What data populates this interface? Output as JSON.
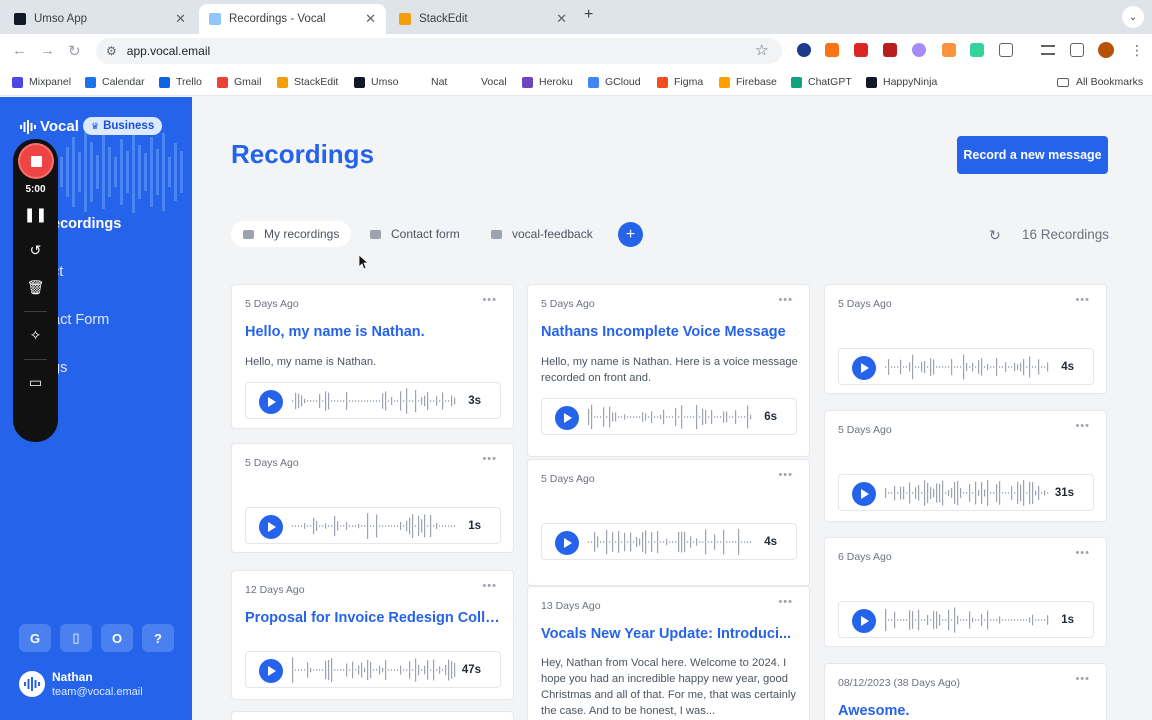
{
  "browser": {
    "tabs": [
      {
        "title": "Umso App",
        "active": false,
        "color": "#111827"
      },
      {
        "title": "Recordings - Vocal",
        "active": true,
        "color": "#60a5fa"
      },
      {
        "title": "StackEdit",
        "active": false,
        "color": "#f59e0b"
      }
    ],
    "url": "app.vocal.email",
    "bookmarks": [
      {
        "label": "Mixpanel",
        "color": "#4f46e5"
      },
      {
        "label": "Calendar",
        "color": "#1a73e8"
      },
      {
        "label": "Trello",
        "color": "#0c66e4"
      },
      {
        "label": "Gmail",
        "color": "#ea4335"
      },
      {
        "label": "StackEdit",
        "color": "#f59e0b"
      },
      {
        "label": "Umso",
        "color": "#111827"
      },
      {
        "label": "Nat",
        "color": "#ffffff"
      },
      {
        "label": "Vocal",
        "color": "#ffffff"
      },
      {
        "label": "Heroku",
        "color": "#6b46c1"
      },
      {
        "label": "GCloud",
        "color": "#4285f4"
      },
      {
        "label": "Figma",
        "color": "#f24e1e"
      },
      {
        "label": "Firebase",
        "color": "#ffa000"
      },
      {
        "label": "ChatGPT",
        "color": "#10a37f"
      },
      {
        "label": "HappyNinja",
        "color": "#111827"
      }
    ],
    "all_bookmarks": "All Bookmarks"
  },
  "sidebar": {
    "brand": "Vocal",
    "plan_badge": "Business",
    "nav": [
      {
        "label": "ecordings",
        "active": true
      },
      {
        "label": "ct",
        "active": false
      },
      {
        "label": "act Form",
        "active": false
      },
      {
        "label": "gs",
        "active": false
      }
    ],
    "integrations": [
      "G",
      "▯",
      "O",
      "?"
    ],
    "user": {
      "name": "Nathan",
      "email": "team@vocal.email"
    }
  },
  "recorder": {
    "time": "5:00"
  },
  "main": {
    "title": "Recordings",
    "record_button": "Record a new message",
    "folders": [
      {
        "label": "My recordings",
        "active": true
      },
      {
        "label": "Contact form",
        "active": false
      },
      {
        "label": "vocal-feedback",
        "active": false
      }
    ],
    "count": "16 Recordings"
  },
  "cards": [
    {
      "date": "5 Days Ago",
      "title": "Hello, my name is Nathan.",
      "body": "Hello, my name is Nathan.",
      "duration": "3s"
    },
    {
      "date": "5 Days Ago",
      "title": "",
      "body": "",
      "duration": "1s"
    },
    {
      "date": "12 Days Ago",
      "title": "Proposal for Invoice Redesign Colla...",
      "body": "",
      "duration": "47s"
    },
    {
      "date": "5 Days Ago",
      "title": "Nathans Incomplete Voice Message",
      "body": "Hello, my name is Nathan. Here is a voice message recorded on front and.",
      "duration": "6s"
    },
    {
      "date": "5 Days Ago",
      "title": "",
      "body": "",
      "duration": "4s"
    },
    {
      "date": "13 Days Ago",
      "title": "Vocals New Year Update: Introduci...",
      "body": "Hey, Nathan from Vocal here. Welcome to 2024. I hope you had an incredible happy new year, good Christmas and all of that. For me, that was certainly the case. And to be honest, I was...",
      "duration": ""
    },
    {
      "date": "5 Days Ago",
      "title": "",
      "body": "",
      "duration": "4s"
    },
    {
      "date": "5 Days Ago",
      "title": "",
      "body": "",
      "duration": "31s"
    },
    {
      "date": "6 Days Ago",
      "title": "",
      "body": "",
      "duration": "1s"
    },
    {
      "date": "08/12/2023 (38 Days Ago)",
      "title": "Awesome.",
      "body": "",
      "duration": ""
    }
  ],
  "colors": {
    "accent": "#2563eb",
    "sidebar": "#2563eb",
    "record_stop": "#ef4444"
  },
  "icons": {
    "play": "play-icon",
    "refresh": "refresh-icon",
    "folder": "folder-icon",
    "menu": "more-icon"
  }
}
